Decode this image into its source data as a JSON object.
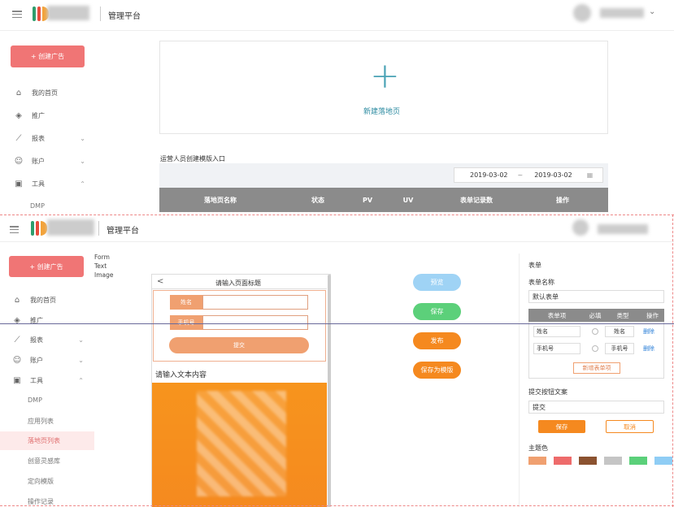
{
  "top": {
    "header_title": "管理平台",
    "create_button": "+ 创建广告",
    "nav": [
      {
        "label": "我的首页",
        "icon": "home-icon"
      },
      {
        "label": "推广",
        "icon": "layers-icon"
      },
      {
        "label": "报表",
        "icon": "chart-icon"
      },
      {
        "label": "账户",
        "icon": "user-icon"
      },
      {
        "label": "工具",
        "icon": "toolbox-icon"
      }
    ],
    "sub_dmp": "DMP",
    "new_page_label": "新建落地页",
    "section_title": "运营人员创建模版入口",
    "date_start": "2019-03-02",
    "date_sep": "~",
    "date_end": "2019-03-02",
    "columns": [
      "落地页名称",
      "状态",
      "PV",
      "UV",
      "表单记录数",
      "操作"
    ]
  },
  "bottom": {
    "header_title": "管理平台",
    "create_button": "+ 创建广告",
    "components": [
      "Form",
      "Text",
      "Image"
    ],
    "nav": [
      {
        "label": "我的首页"
      },
      {
        "label": "推广"
      },
      {
        "label": "报表"
      },
      {
        "label": "账户"
      },
      {
        "label": "工具"
      }
    ],
    "sub_items": [
      "DMP",
      "应用列表",
      "落地页列表",
      "创意灵感库",
      "定向模版",
      "操作记录"
    ],
    "phone": {
      "back": "<",
      "title": "请输入页面标题",
      "field1": "姓名",
      "field2": "手机号",
      "submit": "提交",
      "text_placeholder": "请输入文本内容"
    },
    "actions": {
      "preview": "预览",
      "save": "保存",
      "publish": "发布",
      "save_template": "保存为模版"
    },
    "panel": {
      "heading": "表单",
      "form_name_label": "表单名称",
      "form_name_value": "默认表单",
      "table_headers": [
        "表单项",
        "必填",
        "类型",
        "操作"
      ],
      "rows": [
        {
          "name": "姓名",
          "type": "姓名",
          "op": "删除"
        },
        {
          "name": "手机号",
          "type": "手机号",
          "op": "删除"
        }
      ],
      "add_item": "新增表单项",
      "submit_text_label": "提交按钮文案",
      "submit_text_value": "提交",
      "save": "保存",
      "cancel": "取消",
      "theme_label": "主题色",
      "theme_colors": [
        "#f0a070",
        "#ee6b6b",
        "#8b5230",
        "#c5c5c5",
        "#5bd07a",
        "#8fcdf5"
      ]
    }
  }
}
